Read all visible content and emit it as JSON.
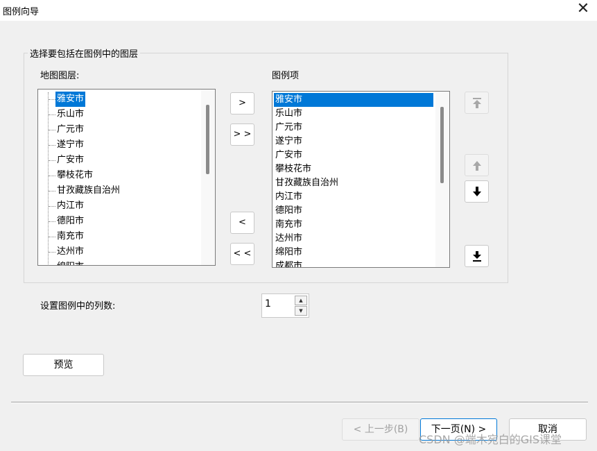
{
  "window": {
    "title": "图例向导"
  },
  "group": {
    "title": "选择要包括在图例中的图层"
  },
  "map_layers": {
    "label": "地图图层:",
    "items": [
      "雅安市",
      "乐山市",
      "广元市",
      "遂宁市",
      "广安市",
      "攀枝花市",
      "甘孜藏族自治州",
      "内江市",
      "德阳市",
      "南充市",
      "达州市",
      "绵阳市"
    ],
    "selected": "雅安市"
  },
  "legend_items": {
    "label": "图例项",
    "items": [
      "雅安市",
      "乐山市",
      "广元市",
      "遂宁市",
      "广安市",
      "攀枝花市",
      "甘孜藏族自治州",
      "内江市",
      "德阳市",
      "南充市",
      "达州市",
      "绵阳市",
      "成都市"
    ],
    "selected": "雅安市"
  },
  "transfer": {
    "add_one": ">",
    "add_all": "> >",
    "remove_one": "<",
    "remove_all": "< <"
  },
  "order_icons": [
    "move-top-icon",
    "move-up-icon",
    "move-down-icon",
    "move-bottom-icon"
  ],
  "columns": {
    "label": "设置图例中的列数:",
    "value": "1"
  },
  "buttons": {
    "preview": "预览",
    "back": "< 上一步(B)",
    "next": "下一页(N) >",
    "cancel": "取消"
  },
  "watermark": "CSDN @端木宛白的GIS课堂",
  "colors": {
    "selection": "#0078d7",
    "background": "#f0f0f0"
  }
}
